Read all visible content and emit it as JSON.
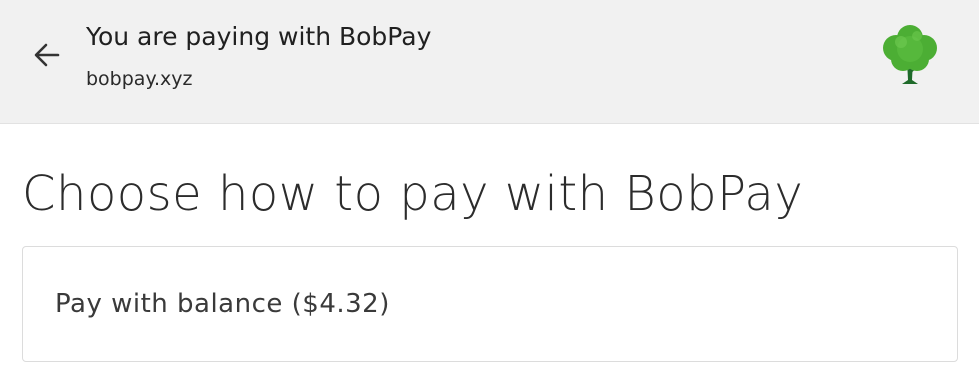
{
  "header": {
    "title": "You are paying with BobPay",
    "origin": "bobpay.xyz",
    "back_icon": "arrow-left-icon",
    "logo_icon": "tree-icon"
  },
  "main": {
    "title": "Choose how to pay with BobPay"
  },
  "options": [
    {
      "label": "Pay with balance ($4.32)"
    }
  ],
  "colors": {
    "header_bg": "#f1f1f1",
    "logo_green": "#4caf32",
    "logo_trunk": "#1f6a2a"
  }
}
